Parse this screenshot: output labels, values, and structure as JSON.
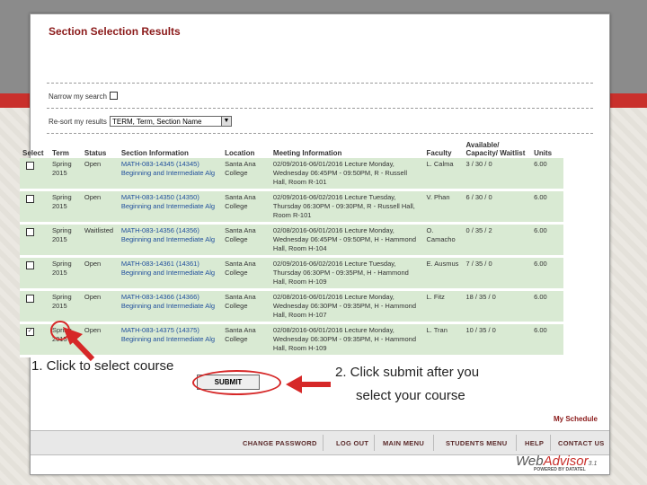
{
  "page": {
    "title": "Section Selection Results",
    "narrow_label": "Narrow my search",
    "sort_label": "Re-sort my results",
    "sort_value": "TERM, Term, Section Name"
  },
  "table": {
    "headers": [
      "Select",
      "Term",
      "Status",
      "Section Information",
      "Location",
      "Meeting Information",
      "Faculty",
      "Available/ Capacity/ Waitlist",
      "Units"
    ],
    "rows": [
      {
        "checked": "",
        "term": "Spring 2015",
        "status": "Open",
        "section": "MATH-083-14345 (14345) Beginning and Intermediate Alg",
        "location": "Santa Ana College",
        "meeting": "02/09/2016-06/01/2016 Lecture Monday, Wednesday 06:45PM - 09:50PM, R - Russell Hall, Room R-101",
        "faculty": "L. Calma",
        "avail": "3 / 30 / 0",
        "units": "6.00"
      },
      {
        "checked": "",
        "term": "Spring 2015",
        "status": "Open",
        "section": "MATH-083-14350 (14350) Beginning and Intermediate Alg",
        "location": "Santa Ana College",
        "meeting": "02/09/2016-06/02/2016 Lecture Tuesday, Thursday 06:30PM - 09:30PM, R - Russell Hall, Room R-101",
        "faculty": "V. Phan",
        "avail": "6 / 30 / 0",
        "units": "6.00"
      },
      {
        "checked": "",
        "term": "Spring 2015",
        "status": "Waitlisted",
        "section": "MATH-083-14356 (14356) Beginning and Intermediate Alg",
        "location": "Santa Ana College",
        "meeting": "02/08/2016-06/01/2016 Lecture Monday, Wednesday 06:45PM - 09:50PM, H - Hammond Hall, Room H-104",
        "faculty": "O. Camacho",
        "avail": "0 / 35 / 2",
        "units": "6.00"
      },
      {
        "checked": "",
        "term": "Spring 2015",
        "status": "Open",
        "section": "MATH-083-14361 (14361) Beginning and Intermediate Alg",
        "location": "Santa Ana College",
        "meeting": "02/09/2016-06/02/2016 Lecture Tuesday, Thursday 06:30PM - 09:35PM, H - Hammond Hall, Room H-109",
        "faculty": "E. Ausmus",
        "avail": "7 / 35 / 0",
        "units": "6.00"
      },
      {
        "checked": "",
        "term": "Spring 2015",
        "status": "Open",
        "section": "MATH-083-14366 (14366) Beginning and Intermediate Alg",
        "location": "Santa Ana College",
        "meeting": "02/08/2016-06/01/2016 Lecture Monday, Wednesday 06:30PM - 09:35PM, H - Hammond Hall, Room H-107",
        "faculty": "L. Fitz",
        "avail": "18 / 35 / 0",
        "units": "6.00"
      },
      {
        "checked": "✓",
        "term": "Spring 2015",
        "status": "Open",
        "section": "MATH-083-14375 (14375) Beginning and Intermediate Alg",
        "location": "Santa Ana College",
        "meeting": "02/08/2016-06/01/2016 Lecture Monday, Wednesday 06:30PM - 09:35PM, H - Hammond Hall, Room H-109",
        "faculty": "L. Tran",
        "avail": "10 / 35 / 0",
        "units": "6.00"
      }
    ]
  },
  "submit_label": "SUBMIT",
  "annotations": {
    "a1": "1. Click to select course",
    "a2_line1": "2. Click submit after you",
    "a2_line2": "select your course"
  },
  "my_schedule": "My Schedule",
  "footer": {
    "links": [
      "CHANGE PASSWORD",
      "LOG OUT",
      "MAIN MENU",
      "STUDENTS MENU",
      "HELP",
      "CONTACT US"
    ]
  },
  "logo": {
    "web": "Web",
    "advisor": "Advisor",
    "version": "3.1",
    "powered": "POWERED BY DATATEL"
  },
  "colors": {
    "accent_red": "#c9302c",
    "row_green": "#d9ead3",
    "title_maroon": "#8b1a1a",
    "link_blue": "#1f4e9c"
  }
}
